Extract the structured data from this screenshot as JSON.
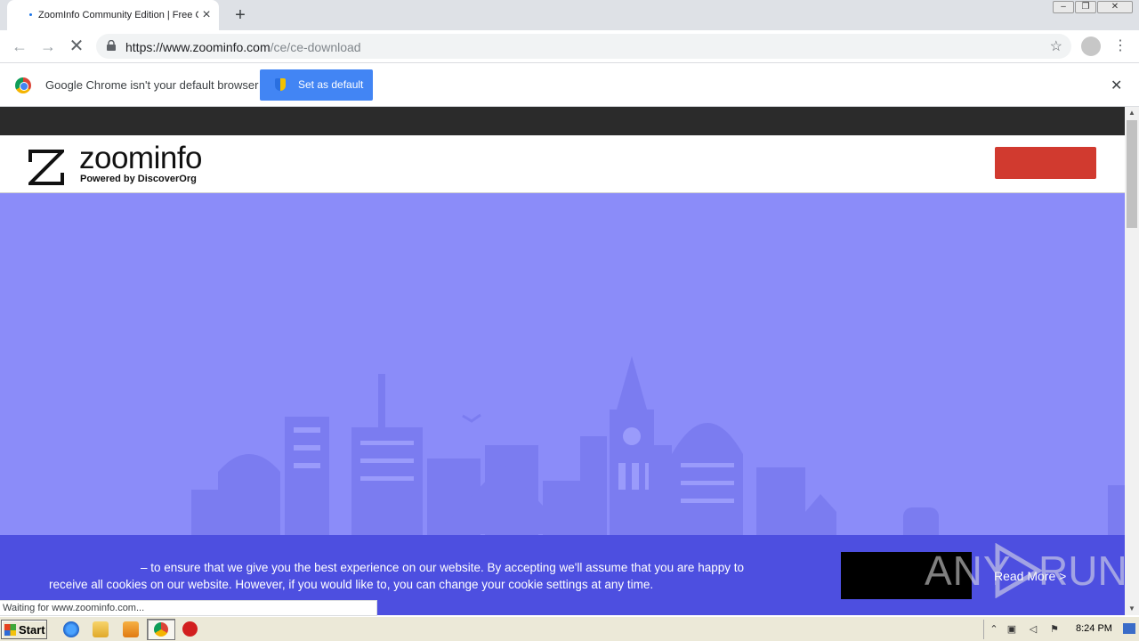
{
  "browser": {
    "tab_title": "ZoomInfo Community Edition | Free Contact Database",
    "url_host": "https://www.zoominfo.com",
    "url_path": "/ce/ce-download",
    "status_text": "Waiting for www.zoominfo.com..."
  },
  "infobar": {
    "message": "Google Chrome isn't your default browser",
    "button_label": "Set as default"
  },
  "site": {
    "logo_word": "zoominfo",
    "logo_sub": "Powered by DiscoverOrg",
    "accent_color": "#8b8cf9",
    "header_button_color": "#d13a2f"
  },
  "cookie_banner": {
    "text_line1": "– to ensure that we give you the best experience on our website. By accepting we'll assume that you are happy to",
    "text_line2": "receive all cookies on our website. However, if you would like to, you can change your cookie settings at any time.",
    "read_more": "Read More >"
  },
  "watermark": {
    "left": "ANY",
    "right": "RUN"
  },
  "taskbar": {
    "start_label": "Start",
    "clock": "8:24 PM"
  }
}
